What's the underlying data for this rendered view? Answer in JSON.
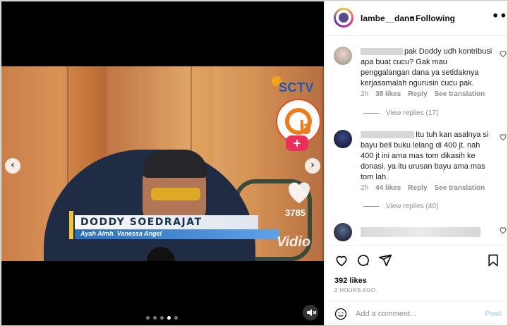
{
  "post": {
    "username": "lambe__danu",
    "separator": "•",
    "follow_state": "Following",
    "more_label": "•••",
    "likes": "392 likes",
    "time": "2 HOURS AGO"
  },
  "video": {
    "channel_logo": "SCTV",
    "name_caption": "DODDY SOEDRAJAT",
    "sub_caption": "Ayah Almh. Vanessa Angel",
    "tiktok_logo_letter": "b",
    "tiktok_follow": "+",
    "like_count": "3785",
    "watermark": "Vidio",
    "prev_icon": "‹",
    "next_icon": "›",
    "dots": 5,
    "active_dot": 3
  },
  "comments": [
    {
      "text": "pak Doddy udh kontribusi apa buat cucu? Gak mau penggalangan dana ya setidaknya kerjasamalah ngurusin cucu pak.",
      "time": "2h",
      "likes": "38 likes",
      "reply": "Reply",
      "translate": "See translation",
      "view_replies": "View replies (17)"
    },
    {
      "text": "Itu tuh kan asalnya si bayu beli buku lelang di 400 jt. nah 400 jt ini ama mas tom dikasih ke donasi. ya itu urusan bayu ama mas tom lah.",
      "time": "2h",
      "likes": "44 likes",
      "reply": "Reply",
      "translate": "See translation",
      "view_replies": "View replies (40)"
    }
  ],
  "composer": {
    "placeholder": "Add a comment...",
    "post_label": "Post"
  },
  "colors": {
    "accent_blue": "#0095f6",
    "post_disabled": "#b3dbff",
    "secondary_text": "#8e8e8e"
  }
}
